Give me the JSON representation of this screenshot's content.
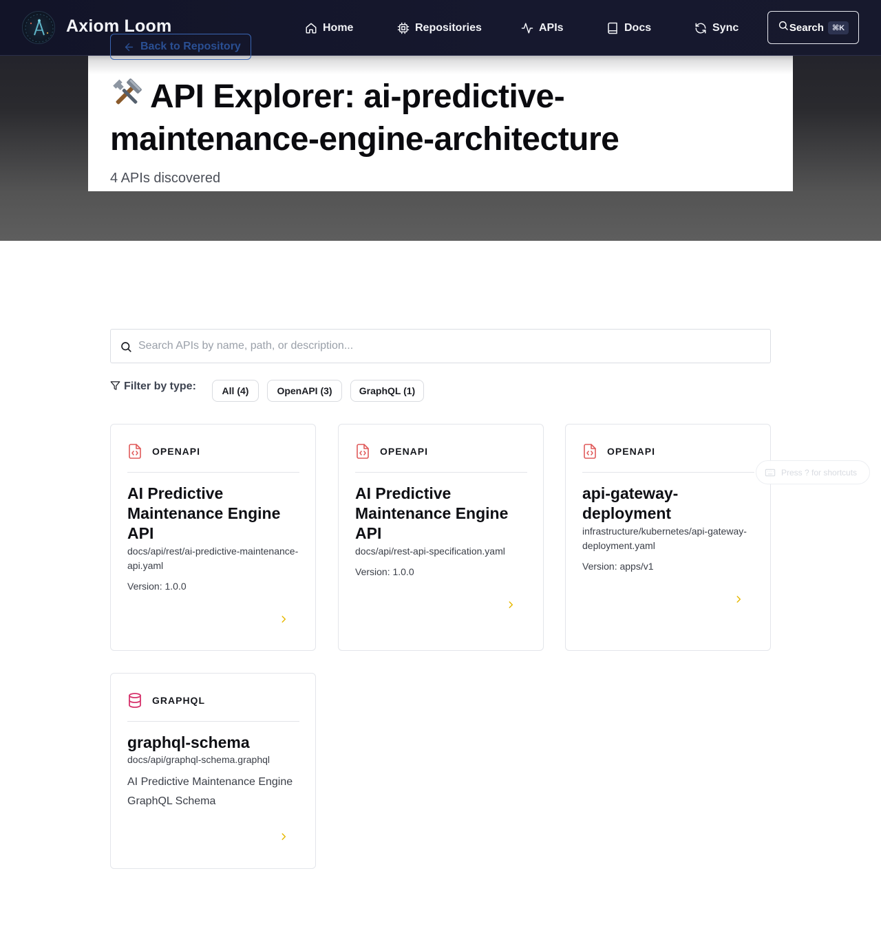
{
  "app": {
    "brand": "Axiom Loom"
  },
  "nav": {
    "items": [
      {
        "label": "Home",
        "icon": "home-icon"
      },
      {
        "label": "Repositories",
        "icon": "chip-icon"
      },
      {
        "label": "APIs",
        "icon": "activity-icon"
      },
      {
        "label": "Docs",
        "icon": "book-icon"
      },
      {
        "label": "Sync",
        "icon": "refresh-icon"
      }
    ],
    "search_label": "Search",
    "search_shortcut": "⌘K"
  },
  "page": {
    "back_label": "Back to Repository",
    "title_emoji": "🛠️",
    "title": "API Explorer: ai-predictive-maintenance-engine-architecture",
    "subtitle": "4 APIs discovered"
  },
  "search": {
    "placeholder": "Search APIs by name, path, or description..."
  },
  "filters": {
    "label": "Filter by type:",
    "chips": [
      "All (4)",
      "OpenAPI (3)",
      "GraphQL (1)"
    ]
  },
  "cards": [
    {
      "type": "OPENAPI",
      "icon": "file-code-icon",
      "title": "AI Predictive Maintenance Engine API",
      "path": "docs/api/rest/ai-predictive-maintenance-api.yaml",
      "version": "Version: 1.0.0"
    },
    {
      "type": "OPENAPI",
      "icon": "file-code-icon",
      "title": "AI Predictive Maintenance Engine API",
      "path": "docs/api/rest-api-specification.yaml",
      "version": "Version: 1.0.0"
    },
    {
      "type": "OPENAPI",
      "icon": "file-code-icon",
      "title": "api-gateway-deployment",
      "path": "infrastructure/kubernetes/api-gateway-deployment.yaml",
      "version": "Version: apps/v1"
    },
    {
      "type": "GRAPHQL",
      "icon": "database-icon",
      "title": "graphql-schema",
      "path": "docs/api/graphql-schema.graphql",
      "description": "AI Predictive Maintenance Engine GraphQL Schema"
    }
  ],
  "hint": {
    "text": "Press ? for shortcuts"
  },
  "colors": {
    "accent_yellow": "#e6b800",
    "openapi_red": "#e05a5a",
    "graphql_pink": "#d6336c",
    "header_bg": "#121428"
  }
}
